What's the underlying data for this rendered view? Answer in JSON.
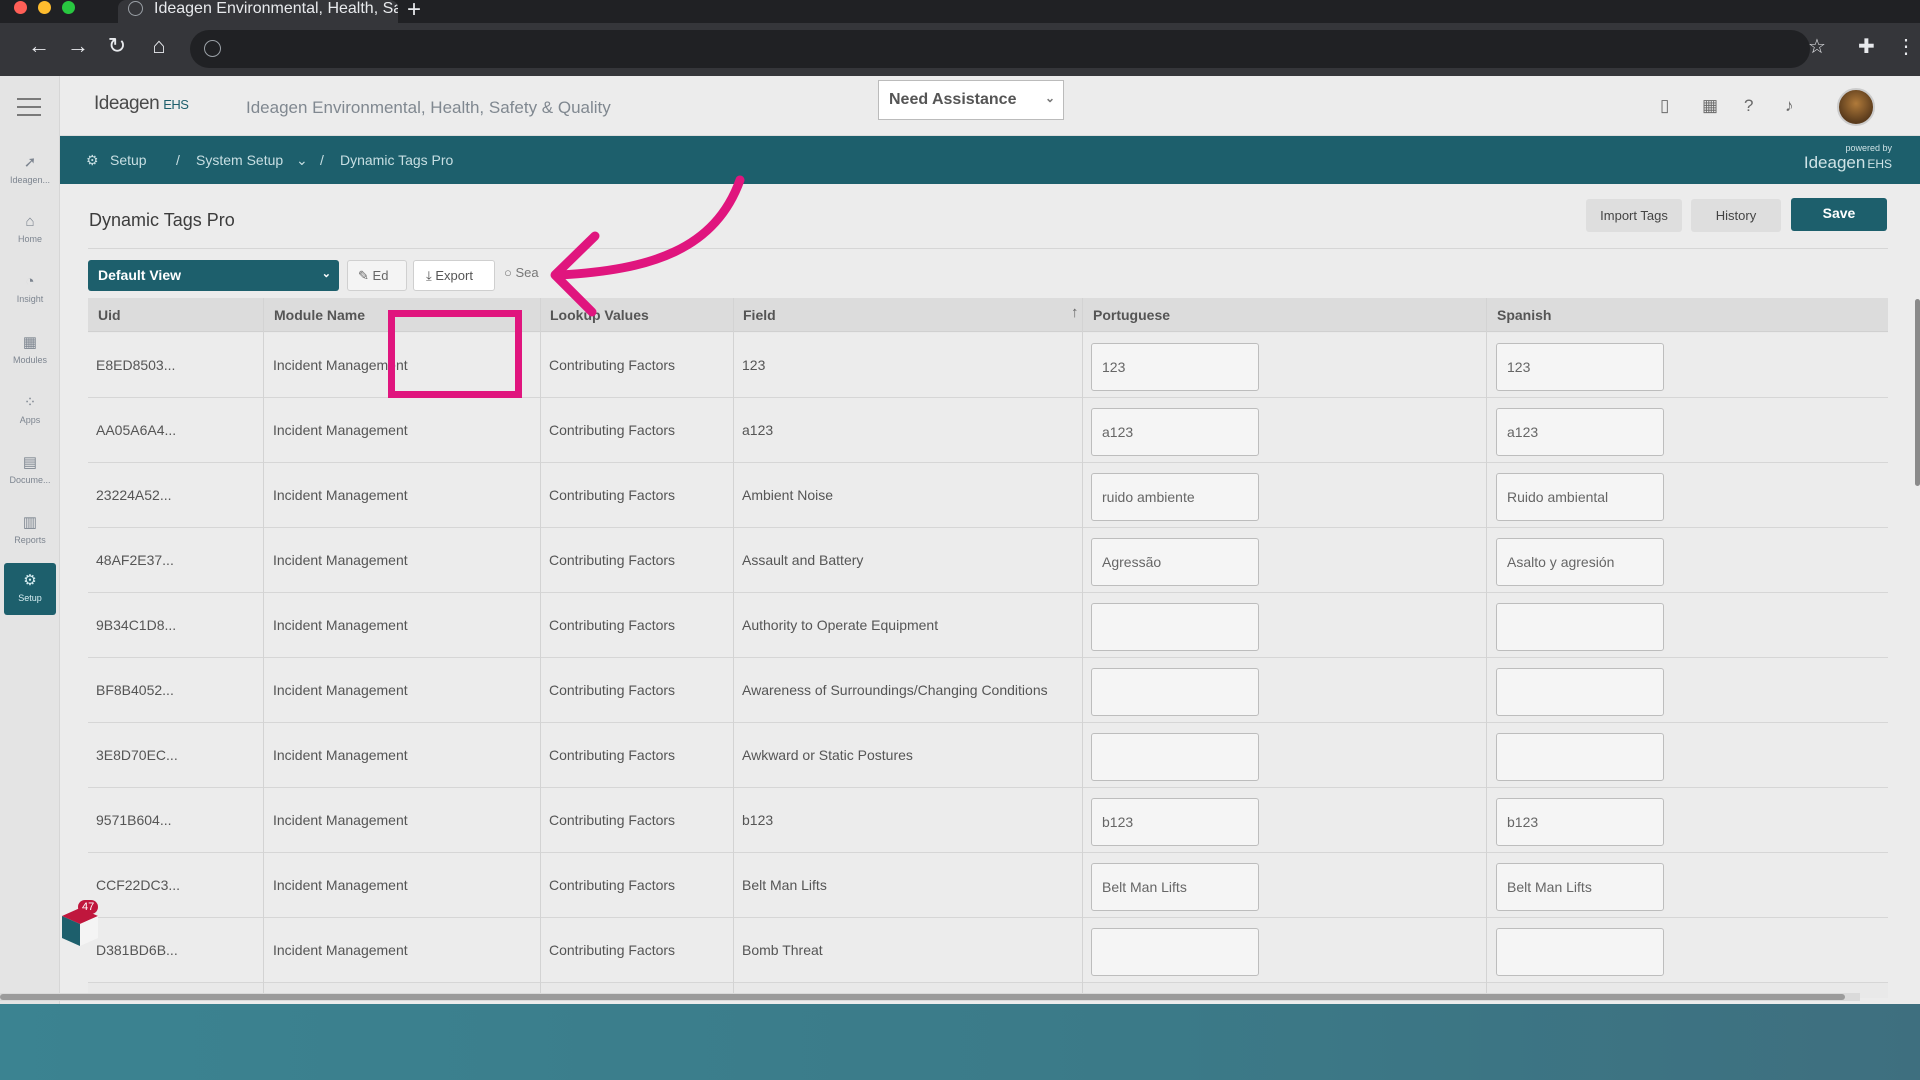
{
  "browser": {
    "tab_title": "Ideagen Environmental, Health, Sa",
    "new_tab": "+",
    "traffic_colors": [
      "#ff5f57",
      "#febc2e",
      "#28c840"
    ]
  },
  "header": {
    "logo_text": "Ideagen",
    "logo_suffix": "EHS",
    "app_title": "Ideagen Environmental, Health, Safety & Quality",
    "assist_label": "Need Assistance"
  },
  "leftnav": {
    "items": [
      {
        "label": "Ideagen...",
        "icon": "ideagen-icon"
      },
      {
        "label": "Home",
        "icon": "home-icon"
      },
      {
        "label": "Insight",
        "icon": "insight-icon"
      },
      {
        "label": "Modules",
        "icon": "modules-icon"
      },
      {
        "label": "Apps",
        "icon": "apps-icon"
      },
      {
        "label": "Docume...",
        "icon": "document-icon"
      },
      {
        "label": "Reports",
        "icon": "reports-icon"
      },
      {
        "label": "Setup",
        "icon": "gear-icon"
      }
    ]
  },
  "breadcrumb": {
    "setup": "Setup",
    "sep1": "/",
    "system_setup": "System Setup",
    "sep2": "/",
    "current": "Dynamic Tags Pro",
    "powered_by": "powered by",
    "powered_logo": "Ideagen",
    "powered_suffix": "EHS"
  },
  "page": {
    "title": "Dynamic Tags Pro",
    "import_tags": "Import Tags",
    "history": "History",
    "save": "Save",
    "view_select": "Default View",
    "edit_label": "Ed",
    "export_label": "Export",
    "search_hint": "Sea"
  },
  "table": {
    "columns": [
      "Uid",
      "Module Name",
      "Lookup Values",
      "Field",
      "Portuguese",
      "Spanish"
    ],
    "rows": [
      {
        "uid": "E8ED8503...",
        "module": "Incident Management",
        "lookup": "Contributing Factors",
        "field": "123",
        "pt": "123",
        "es": "123"
      },
      {
        "uid": "AA05A6A4...",
        "module": "Incident Management",
        "lookup": "Contributing Factors",
        "field": "a123",
        "pt": "a123",
        "es": "a123"
      },
      {
        "uid": "23224A52...",
        "module": "Incident Management",
        "lookup": "Contributing Factors",
        "field": "Ambient Noise",
        "pt": "ruido ambiente",
        "es": "Ruido ambiental"
      },
      {
        "uid": "48AF2E37...",
        "module": "Incident Management",
        "lookup": "Contributing Factors",
        "field": "Assault and Battery",
        "pt": "Agressão",
        "es": "Asalto y agresión"
      },
      {
        "uid": "9B34C1D8...",
        "module": "Incident Management",
        "lookup": "Contributing Factors",
        "field": "Authority to Operate Equipment",
        "pt": "",
        "es": ""
      },
      {
        "uid": "BF8B4052...",
        "module": "Incident Management",
        "lookup": "Contributing Factors",
        "field": "Awareness of Surroundings/Changing Conditions",
        "pt": "",
        "es": ""
      },
      {
        "uid": "3E8D70EC...",
        "module": "Incident Management",
        "lookup": "Contributing Factors",
        "field": "Awkward or Static Postures",
        "pt": "",
        "es": ""
      },
      {
        "uid": "9571B604...",
        "module": "Incident Management",
        "lookup": "Contributing Factors",
        "field": "b123",
        "pt": "b123",
        "es": "b123"
      },
      {
        "uid": "CCF22DC3...",
        "module": "Incident Management",
        "lookup": "Contributing Factors",
        "field": "Belt Man Lifts",
        "pt": "Belt Man Lifts",
        "es": "Belt Man Lifts"
      },
      {
        "uid": "D381BD6B...",
        "module": "Incident Management",
        "lookup": "Contributing Factors",
        "field": "Bomb Threat",
        "pt": "",
        "es": ""
      }
    ]
  },
  "widget": {
    "badge": "47"
  },
  "colors": {
    "brand": "#1d5f6c",
    "highlight": "#e0157e"
  }
}
